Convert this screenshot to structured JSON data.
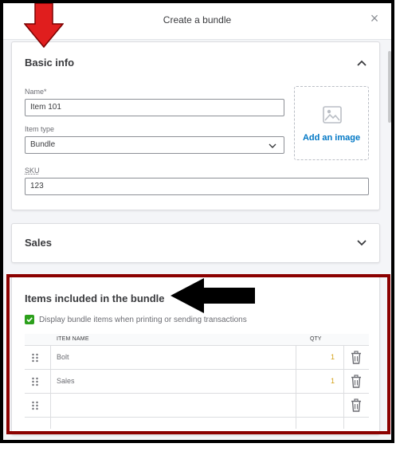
{
  "dialog": {
    "title": "Create a bundle",
    "close_glyph": "×"
  },
  "basic_info": {
    "title": "Basic info",
    "name_label": "Name*",
    "name_value": "Item 101",
    "item_type_label": "Item type",
    "item_type_value": "Bundle",
    "sku_label": "SKU",
    "sku_value": "123",
    "add_image_label": "Add an image"
  },
  "sales": {
    "title": "Sales"
  },
  "items": {
    "title": "Items included in the bundle",
    "display_checkbox_label": "Display bundle items when printing or sending transactions",
    "display_checked": true,
    "columns": {
      "item_name": "ITEM NAME",
      "qty": "QTY"
    },
    "rows": [
      {
        "name": "Bolt",
        "qty": "1"
      },
      {
        "name": "Sales",
        "qty": "1"
      },
      {
        "name": "",
        "qty": ""
      }
    ]
  },
  "icons": {
    "close": "close-icon",
    "collapse": "chevron-up-icon",
    "expand": "chevron-down-icon",
    "image": "image-icon",
    "drag": "drag-handle-icon",
    "delete": "trash-icon",
    "check": "check-icon"
  },
  "colors": {
    "accent_blue": "#0077c5",
    "check_green": "#2ca01c",
    "annotation_red": "#8b0000",
    "arrow_red": "#e01e1e"
  }
}
